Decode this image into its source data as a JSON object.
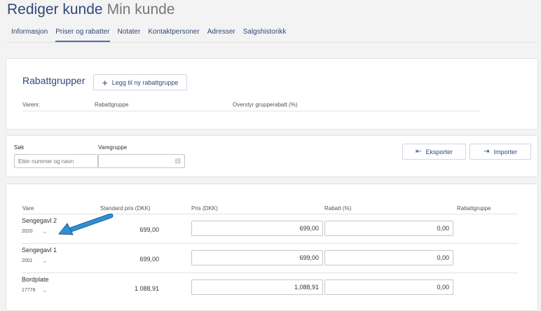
{
  "header": {
    "title": "Rediger kunde",
    "subtitle": "Min kunde"
  },
  "tabs": [
    {
      "label": "Informasjon"
    },
    {
      "label": "Priser og rabatter",
      "active": true
    },
    {
      "label": "Notater"
    },
    {
      "label": "Kontaktpersoner"
    },
    {
      "label": "Adresser"
    },
    {
      "label": "Salgshistorikk"
    }
  ],
  "rabattgrupper": {
    "title": "Rabattgrupper",
    "add_label": "Legg til ny rabattgruppe",
    "columns": [
      "Varenr.",
      "Rabattgruppe",
      "Overstyr grupperabatt (%)"
    ]
  },
  "filters": {
    "search_label": "Søk",
    "search_placeholder": "Etter nummer og navn",
    "group_label": "Varegruppe",
    "group_value": "",
    "export_label": "Eksporter",
    "import_label": "Importer"
  },
  "products": {
    "columns": [
      "Vare",
      "Standard pris (DKK)",
      "Pris (DKK)",
      "Rabatt (%)",
      "Rabattgruppe"
    ],
    "rows": [
      {
        "name": "Sengegavl 2",
        "number": "2020",
        "standard": "699,00",
        "price": "699,00",
        "discount": "0,00"
      },
      {
        "name": "Sengegavl 1",
        "number": "2001",
        "standard": "699,00",
        "price": "699,00",
        "discount": "0,00"
      },
      {
        "name": "Bordplate",
        "number": "17778",
        "standard": "1 088,91",
        "price": "1,088,91",
        "discount": "0,00"
      }
    ]
  },
  "colors": {
    "accent": "#30487a",
    "arrow": "#2f8fd2"
  },
  "icons": [
    "plus-icon",
    "export-icon",
    "import-icon",
    "dropdown-icon",
    "chevron-down-icon",
    "arrow-annotation"
  ]
}
